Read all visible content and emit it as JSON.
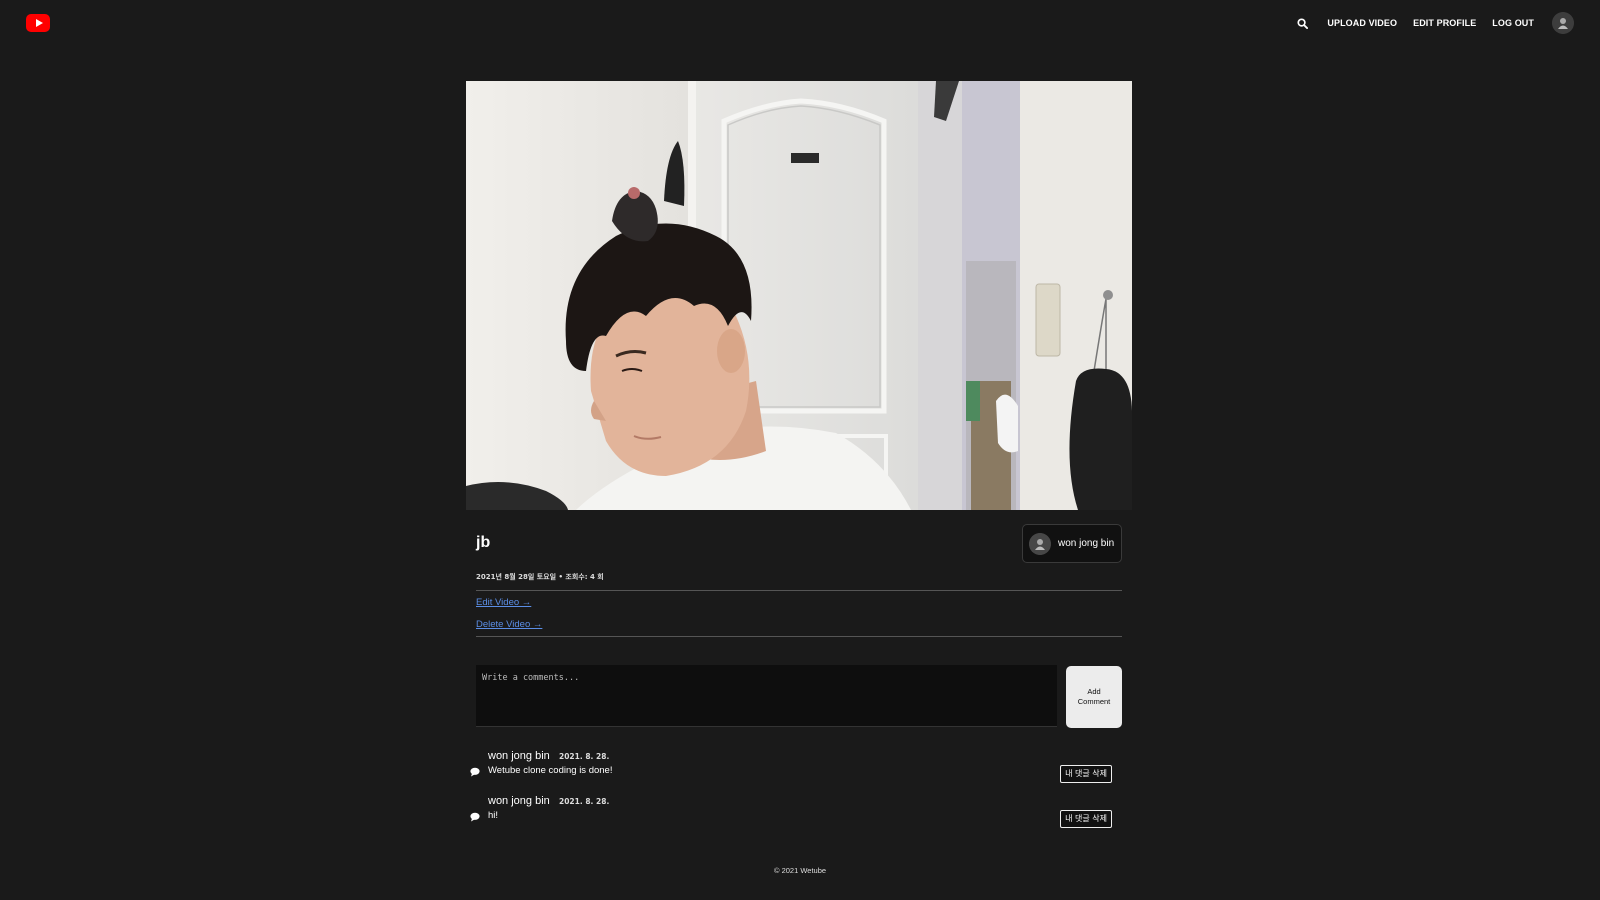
{
  "header": {
    "logo_icon": "youtube-logo-icon",
    "search_icon": "search-icon",
    "links": [
      {
        "label": "UPLOAD VIDEO"
      },
      {
        "label": "EDIT PROFILE"
      },
      {
        "label": "LOG OUT"
      }
    ],
    "avatar_icon": "user-avatar-icon"
  },
  "video": {
    "title": "jb",
    "meta": "2021년 8월 28일 토요일 • 조회수: 4 회",
    "owner": {
      "name": "won jong bin"
    },
    "edit_label": "Edit Video →",
    "delete_label": "Delete Video →"
  },
  "comment_form": {
    "placeholder": "Write a comments...",
    "button_label": "Add Comment"
  },
  "comments": [
    {
      "author": "won jong bin",
      "date": "2021. 8. 28.",
      "text": "Wetube clone coding is done!",
      "delete_label": "내 댓글 삭제"
    },
    {
      "author": "won jong bin",
      "date": "2021. 8. 28.",
      "text": "hi!",
      "delete_label": "내 댓글 삭제"
    }
  ],
  "footer": {
    "text": "© 2021 Wetube"
  },
  "colors": {
    "background": "#1a1a1a",
    "brand": "#ff0000",
    "link": "#5b8ee6"
  }
}
